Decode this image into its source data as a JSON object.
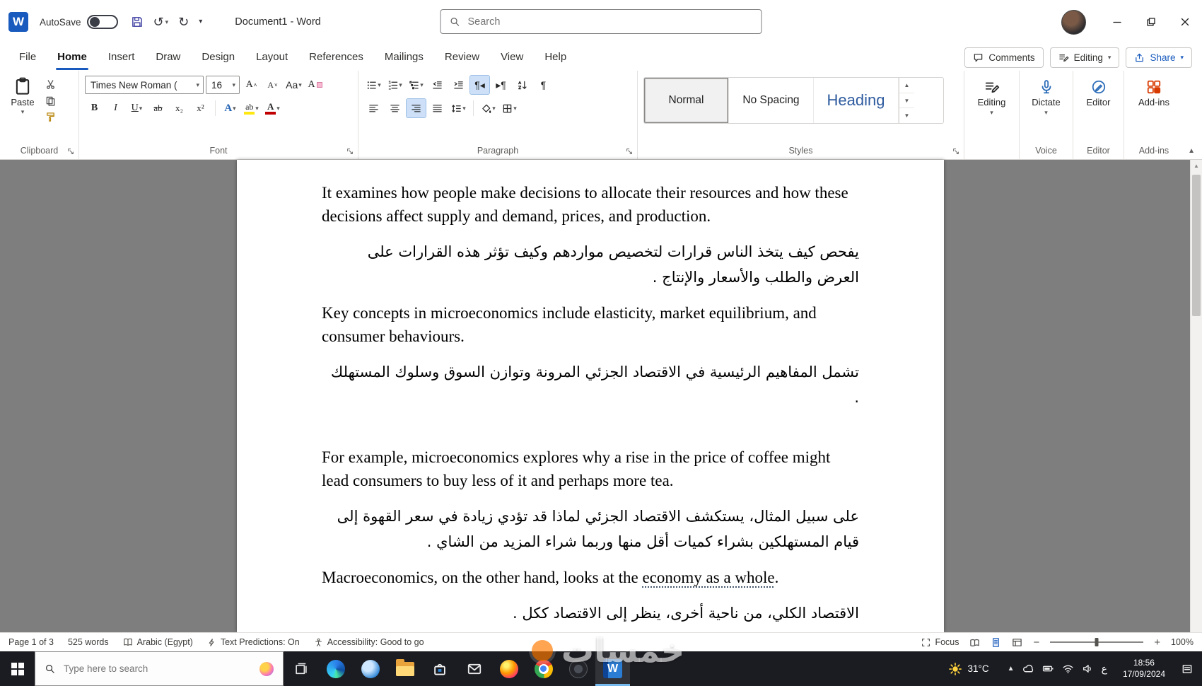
{
  "colors": {
    "accent": "#185abd",
    "heading_blue": "#2e5b9f",
    "canvas": "#7e7e7e",
    "taskbar": "#1b1c22",
    "addins_orange": "#d83b01",
    "highlight_yellow": "#ffe812",
    "font_color_red": "#c00000"
  },
  "titlebar": {
    "word_logo": "W",
    "autosave_label": "AutoSave",
    "document_title": "Document1 - Word",
    "search_placeholder": "Search"
  },
  "ribbon": {
    "tabs": [
      "File",
      "Home",
      "Insert",
      "Draw",
      "Design",
      "Layout",
      "References",
      "Mailings",
      "Review",
      "View",
      "Help"
    ],
    "comments_label": "Comments",
    "editing_label": "Editing",
    "share_label": "Share",
    "clipboard": {
      "paste_label": "Paste",
      "group_label": "Clipboard"
    },
    "font": {
      "font_name": "Times New Roman (",
      "font_size": "16",
      "group_label": "Font"
    },
    "paragraph": {
      "group_label": "Paragraph"
    },
    "styles": {
      "items": [
        "Normal",
        "No Spacing",
        "Heading"
      ],
      "group_label": "Styles"
    },
    "editing_button_label": "Editing",
    "voice": {
      "dictate_label": "Dictate",
      "group_label": "Voice"
    },
    "editor": {
      "editor_label": "Editor",
      "group_label": "Editor"
    },
    "addins": {
      "addins_label": "Add-ins",
      "group_label": "Add-ins"
    },
    "glyphs": {
      "bold": "B",
      "italic": "I",
      "underline": "U",
      "strikethrough": "ab",
      "subscript": "x₂",
      "superscript": "x²",
      "change_case": "Aa",
      "clear_formatting": "A",
      "grow_font": "A",
      "shrink_font": "A",
      "text_effects": "A",
      "font_color": "A",
      "highlight": "ab",
      "pilcrow": "¶",
      "rtl_direction": "¶◂",
      "ltr_direction": "▸¶"
    }
  },
  "document": {
    "paragraphs": [
      {
        "lang": "en",
        "text": "It examines how people make decisions to allocate their resources and how these decisions affect supply and demand, prices, and production."
      },
      {
        "lang": "ar",
        "text": "يفحص كيف يتخذ الناس قرارات لتخصيص مواردهم وكيف تؤثر هذه القرارات على العرض والطلب والأسعار والإنتاج ."
      },
      {
        "lang": "en",
        "text": "Key concepts in microeconomics include elasticity, market equilibrium, and consumer behaviours."
      },
      {
        "lang": "ar",
        "text": "تشمل المفاهيم الرئيسية في الاقتصاد الجزئي المرونة وتوازن السوق وسلوك المستهلك ."
      },
      {
        "lang": "en",
        "text": "For example, microeconomics explores why a rise in the price of coffee might lead consumers to buy less of it and perhaps more tea."
      },
      {
        "lang": "ar",
        "text": "على سبيل المثال، يستكشف الاقتصاد الجزئي لماذا قد تؤدي زيادة في سعر القهوة إلى قيام المستهلكين بشراء كميات أقل منها وربما شراء المزيد من الشاي ."
      },
      {
        "lang": "en",
        "prefix": "Macroeconomics, on the other hand, looks at the ",
        "underlined": "economy as a whole",
        "suffix": "."
      },
      {
        "lang": "ar",
        "text": "الاقتصاد الكلي، من ناحية أخرى، ينظر إلى الاقتصاد ككل ."
      }
    ]
  },
  "statusbar": {
    "page": "Page 1 of 3",
    "word_count": "525 words",
    "language": "Arabic (Egypt)",
    "text_predictions": "Text Predictions: On",
    "accessibility": "Accessibility: Good to go",
    "focus_label": "Focus",
    "zoom_level": "100%"
  },
  "taskbar": {
    "search_placeholder": "Type here to search",
    "weather": "31°C",
    "input_language": "ع",
    "time": "18:56",
    "date": "17/09/2024"
  },
  "watermark": {
    "brand": "خمسات"
  }
}
